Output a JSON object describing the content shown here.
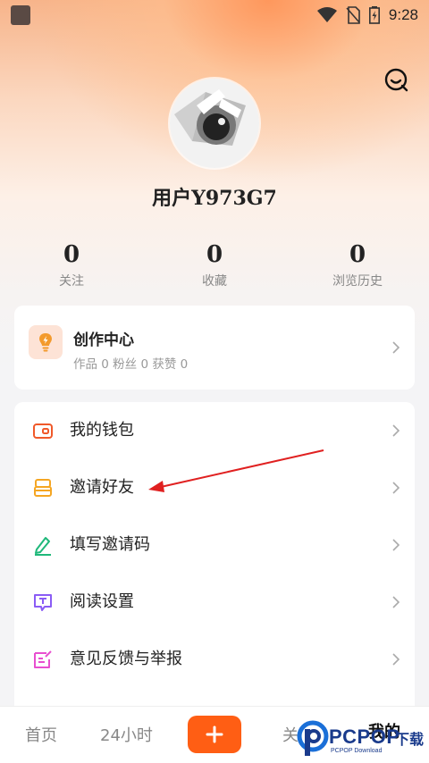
{
  "status_bar": {
    "time": "9:28"
  },
  "profile": {
    "username": "用户Y973G7"
  },
  "stats": [
    {
      "value": "0",
      "label": "关注"
    },
    {
      "value": "0",
      "label": "收藏"
    },
    {
      "value": "0",
      "label": "浏览历史"
    }
  ],
  "creator_center": {
    "title": "创作中心",
    "subtitle": "作品 0 粉丝 0 获赞 0"
  },
  "menu": [
    {
      "label": "我的钱包",
      "icon": "wallet-icon",
      "color": "#f0592a"
    },
    {
      "label": "邀请好友",
      "icon": "invite-icon",
      "color": "#f5a623"
    },
    {
      "label": "填写邀请码",
      "icon": "pencil-icon",
      "color": "#1fb87a"
    },
    {
      "label": "阅读设置",
      "icon": "text-settings-icon",
      "color": "#8a5cf5"
    },
    {
      "label": "意见反馈与举报",
      "icon": "feedback-icon",
      "color": "#e84fd0"
    }
  ],
  "bottom_nav": {
    "home": "首页",
    "hours": "24小时",
    "follow": "关注",
    "mine": "我的"
  },
  "watermark": {
    "brand": "PCPOP",
    "sub": "PCPOP Download",
    "download": "下载"
  },
  "colors": {
    "accent": "#ff5e14",
    "annotation_arrow": "#e02020"
  }
}
